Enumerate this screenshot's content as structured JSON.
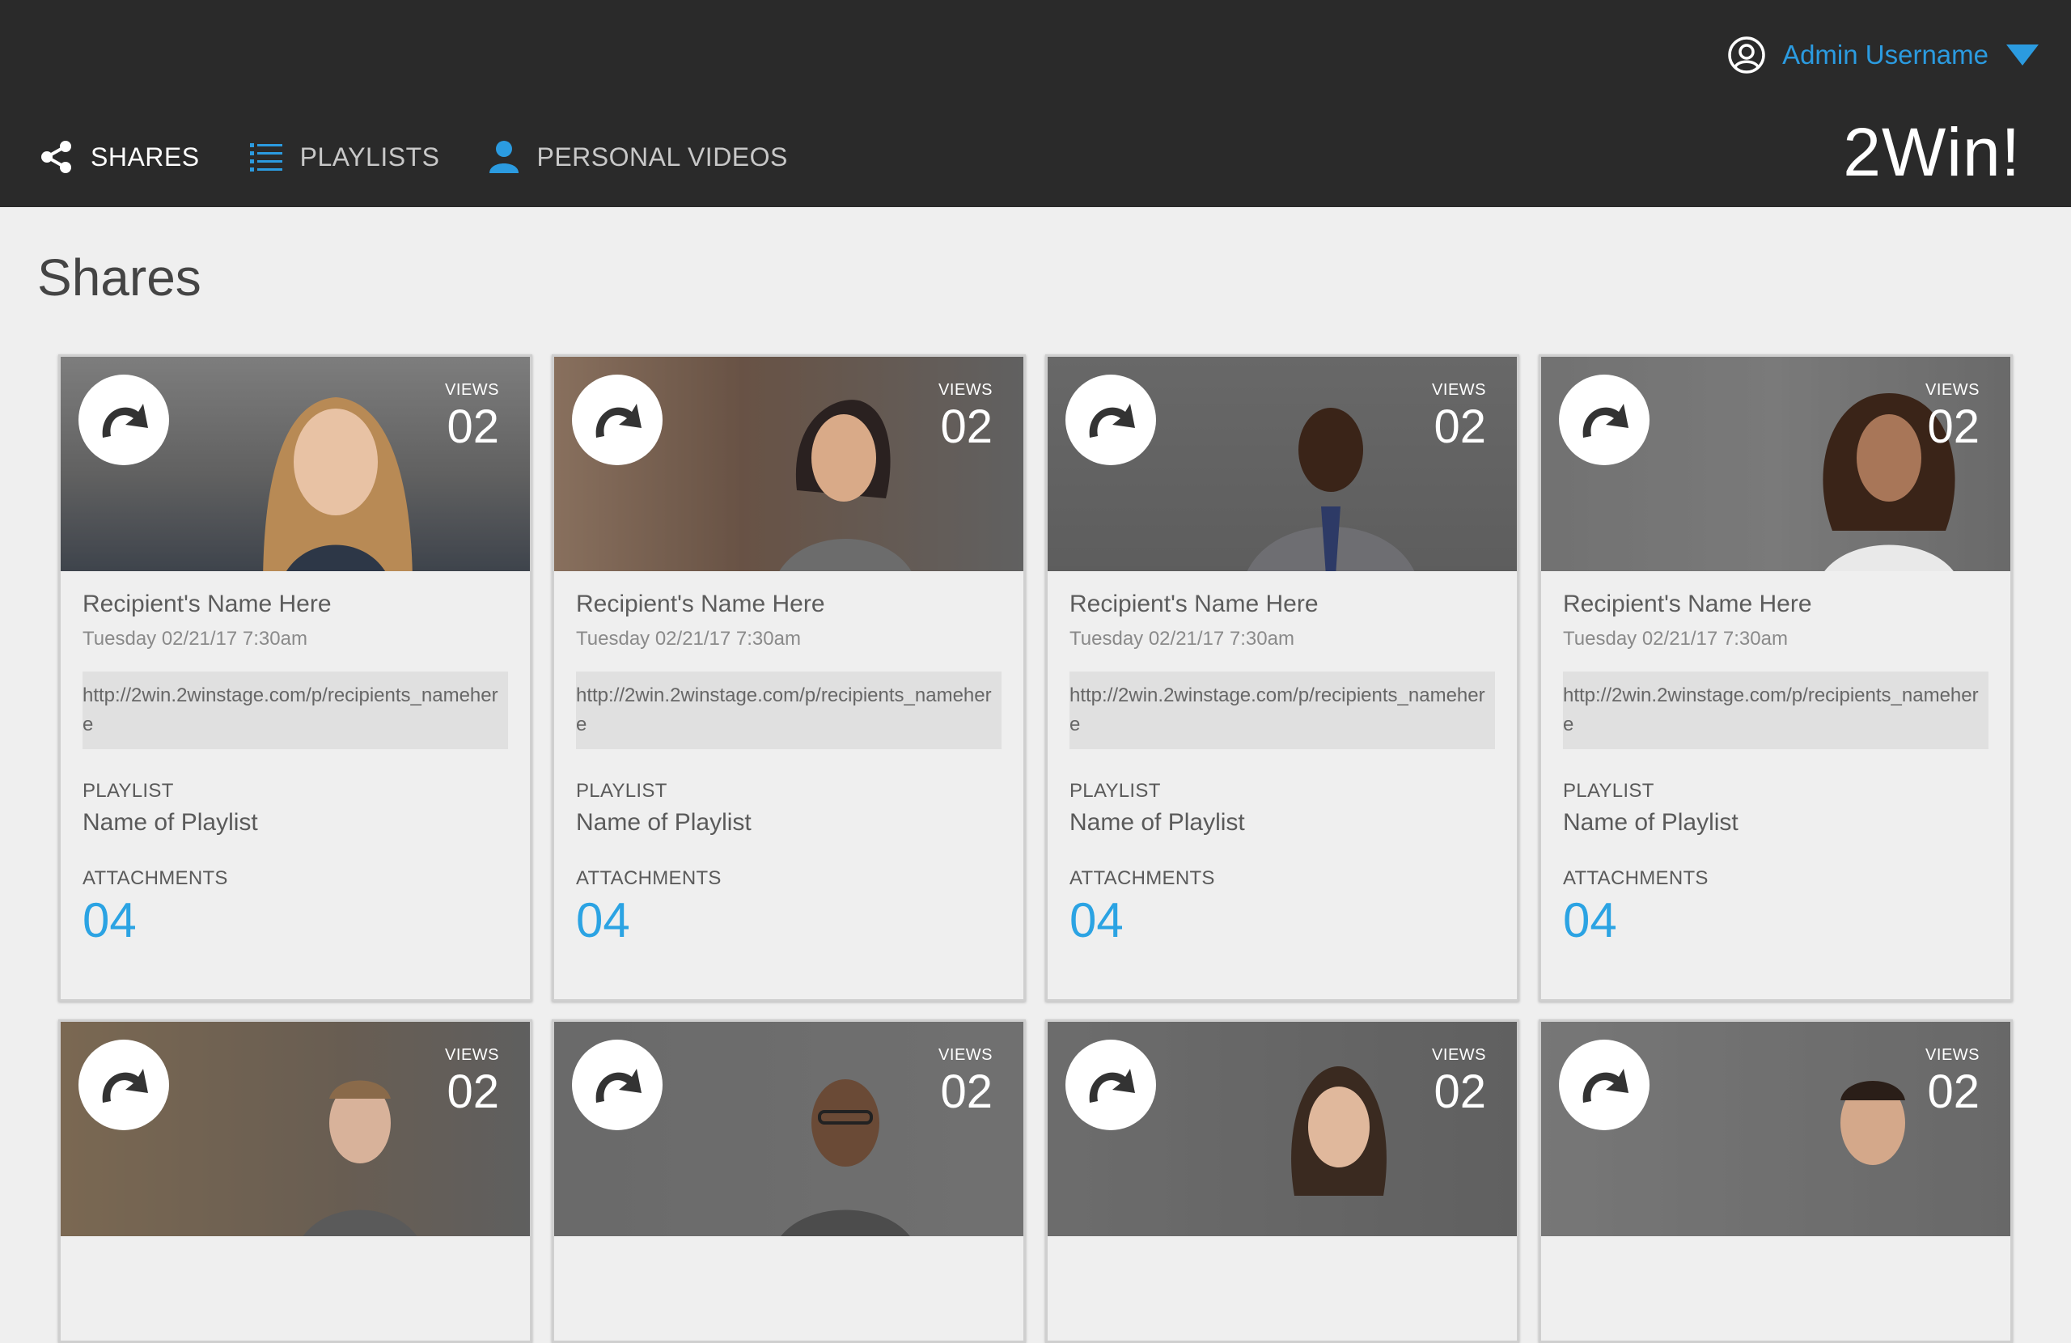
{
  "app": {
    "brand": "2Win!",
    "user_name": "Admin Username",
    "accent": "#2b9be0",
    "topbar_color": "#2a2a2a"
  },
  "nav": [
    {
      "label": "SHARES",
      "icon": "share-icon",
      "active": true
    },
    {
      "label": "PLAYLISTS",
      "icon": "list-icon",
      "active": false
    },
    {
      "label": "PERSONAL VIDEOS",
      "icon": "person-icon",
      "active": false
    }
  ],
  "page": {
    "title": "Shares"
  },
  "card_labels": {
    "views": "VIEWS",
    "playlist": "PLAYLIST",
    "attachments": "ATTACHMENTS"
  },
  "cards": [
    {
      "views": "02",
      "recipient": "Recipient's Name Here",
      "date": "Tuesday 02/21/17 7:30am",
      "url": "http://2win.2winstage.com/p/recipients_nameher e",
      "playlist": "Name of Playlist",
      "attachments": "04"
    },
    {
      "views": "02",
      "recipient": "Recipient's Name Here",
      "date": "Tuesday 02/21/17 7:30am",
      "url": "http://2win.2winstage.com/p/recipients_nameher e",
      "playlist": "Name of Playlist",
      "attachments": "04"
    },
    {
      "views": "02",
      "recipient": "Recipient's Name Here",
      "date": "Tuesday 02/21/17 7:30am",
      "url": "http://2win.2winstage.com/p/recipients_nameher e",
      "playlist": "Name of Playlist",
      "attachments": "04"
    },
    {
      "views": "02",
      "recipient": "Recipient's Name Here",
      "date": "Tuesday 02/21/17 7:30am",
      "url": "http://2win.2winstage.com/p/recipients_nameher e",
      "playlist": "Name of Playlist",
      "attachments": "04"
    },
    {
      "views": "02"
    },
    {
      "views": "02"
    },
    {
      "views": "02"
    },
    {
      "views": "02"
    }
  ]
}
